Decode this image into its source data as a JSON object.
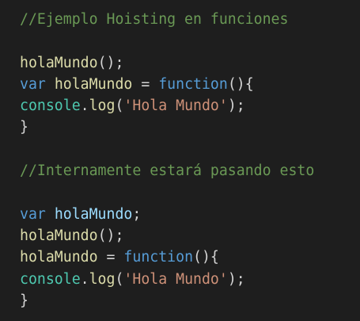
{
  "editor": {
    "colors": {
      "background": "#1e1e1e",
      "comment": "#6a9955",
      "keyword": "#569cd6",
      "function": "#dcdcaa",
      "plain": "#d4d4d4",
      "identifier": "#9cdcfe",
      "class": "#4ec9b0",
      "string": "#ce9178"
    },
    "lines": [
      {
        "tokens": [
          {
            "text": "//Ejemplo Hoisting en funciones",
            "kind": "comment"
          }
        ]
      },
      {
        "tokens": []
      },
      {
        "tokens": [
          {
            "text": "holaMundo",
            "kind": "func"
          },
          {
            "text": "();",
            "kind": "plain"
          }
        ]
      },
      {
        "tokens": [
          {
            "text": "var",
            "kind": "keyword"
          },
          {
            "text": " ",
            "kind": "plain"
          },
          {
            "text": "holaMundo",
            "kind": "func"
          },
          {
            "text": " = ",
            "kind": "plain"
          },
          {
            "text": "function",
            "kind": "keyword"
          },
          {
            "text": "(){",
            "kind": "plain"
          }
        ]
      },
      {
        "tokens": [
          {
            "text": "console",
            "kind": "cls"
          },
          {
            "text": ".",
            "kind": "plain"
          },
          {
            "text": "log",
            "kind": "func"
          },
          {
            "text": "(",
            "kind": "plain"
          },
          {
            "text": "'Hola Mundo'",
            "kind": "str"
          },
          {
            "text": ");",
            "kind": "plain"
          }
        ]
      },
      {
        "tokens": [
          {
            "text": "}",
            "kind": "plain"
          }
        ]
      },
      {
        "tokens": []
      },
      {
        "tokens": [
          {
            "text": "//Internamente estará pasando esto",
            "kind": "comment"
          }
        ]
      },
      {
        "tokens": []
      },
      {
        "tokens": [
          {
            "text": "var",
            "kind": "keyword"
          },
          {
            "text": " ",
            "kind": "plain"
          },
          {
            "text": "holaMundo",
            "kind": "ident"
          },
          {
            "text": ";",
            "kind": "plain"
          }
        ]
      },
      {
        "tokens": [
          {
            "text": "holaMundo",
            "kind": "func"
          },
          {
            "text": "();",
            "kind": "plain"
          }
        ]
      },
      {
        "tokens": [
          {
            "text": "holaMundo",
            "kind": "func"
          },
          {
            "text": " = ",
            "kind": "plain"
          },
          {
            "text": "function",
            "kind": "keyword"
          },
          {
            "text": "(){",
            "kind": "plain"
          }
        ]
      },
      {
        "tokens": [
          {
            "text": "console",
            "kind": "cls"
          },
          {
            "text": ".",
            "kind": "plain"
          },
          {
            "text": "log",
            "kind": "func"
          },
          {
            "text": "(",
            "kind": "plain"
          },
          {
            "text": "'Hola Mundo'",
            "kind": "str"
          },
          {
            "text": ");",
            "kind": "plain"
          }
        ]
      },
      {
        "tokens": [
          {
            "text": "}",
            "kind": "plain"
          }
        ]
      }
    ]
  }
}
